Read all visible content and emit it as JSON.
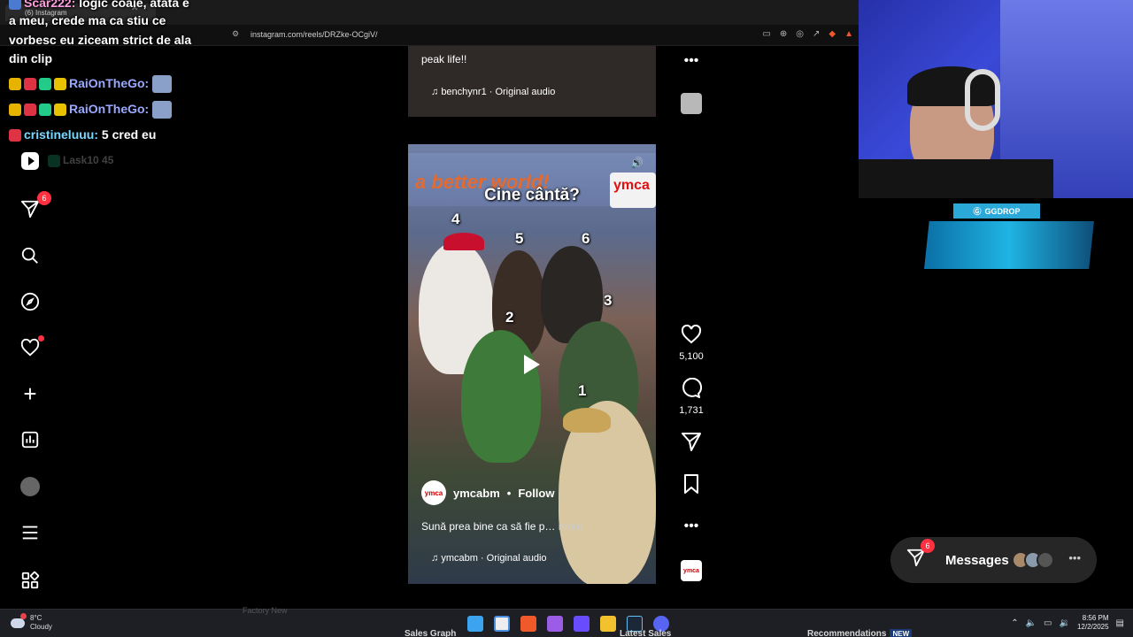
{
  "browser": {
    "tab_title": "(6) Instagram",
    "url": "instagram.com/reels/DRZke-OCgiV/"
  },
  "chat": {
    "lines": [
      {
        "user": "Scar222:",
        "text": "logic coaie, atata e"
      },
      {
        "text": "a meu, crede ma ca stiu ce"
      },
      {
        "text": "vorbesc eu ziceam strict de ala"
      },
      {
        "text": "din clip"
      },
      {
        "user": "RaiOnTheGo:"
      },
      {
        "user": "RaiOnTheGo:"
      },
      {
        "user": "cristineluuu:",
        "text": "5 cred eu"
      },
      {
        "user": "Lask10",
        "text": "45"
      }
    ]
  },
  "sidebar": {
    "items": [
      {
        "name": "reels",
        "icon": "reels-icon"
      },
      {
        "name": "messages",
        "icon": "paper-plane-icon",
        "badge": "6"
      },
      {
        "name": "search",
        "icon": "search-icon"
      },
      {
        "name": "explore",
        "icon": "compass-icon"
      },
      {
        "name": "notifications",
        "icon": "heart-icon"
      },
      {
        "name": "create",
        "icon": "plus-icon"
      },
      {
        "name": "dashboard",
        "icon": "chart-icon"
      },
      {
        "name": "profile",
        "icon": "avatar-icon"
      },
      {
        "name": "more",
        "icon": "menu-icon"
      },
      {
        "name": "also-from-meta",
        "icon": "grid-icon"
      }
    ]
  },
  "prev_reel": {
    "caption": "peak life!!",
    "audio": "benchynr1 · Original audio"
  },
  "reel": {
    "banner": "a better world!",
    "ymca_logo": "ymca",
    "overlay_title": "Cine cântă?",
    "numbers": [
      "4",
      "5",
      "6",
      "3",
      "2",
      "1"
    ],
    "author": "ymcabm",
    "author_logo": "ymca",
    "follow": "Follow",
    "caption": "Sună prea bine ca să fie p…",
    "more": "more",
    "audio": "ymcabm · Original audio"
  },
  "actions": {
    "likes": "5,100",
    "comments": "1,731"
  },
  "ggdrop": {
    "label": "GGDROP"
  },
  "messages": {
    "label": "Messages",
    "badge": "6"
  },
  "taskbar": {
    "temp": "8°C",
    "weather": "Cloudy",
    "ghost_left": "Sales Graph",
    "ghost_mid": "Latest Sales",
    "ghost_right": "Recommendations",
    "new_badge": "NEW",
    "faint_top": "Factory New",
    "time": "8:56 PM",
    "date": "12/2/2025"
  },
  "colors": {
    "accent_red": "#ff3040",
    "instagram_bg": "#000000"
  }
}
